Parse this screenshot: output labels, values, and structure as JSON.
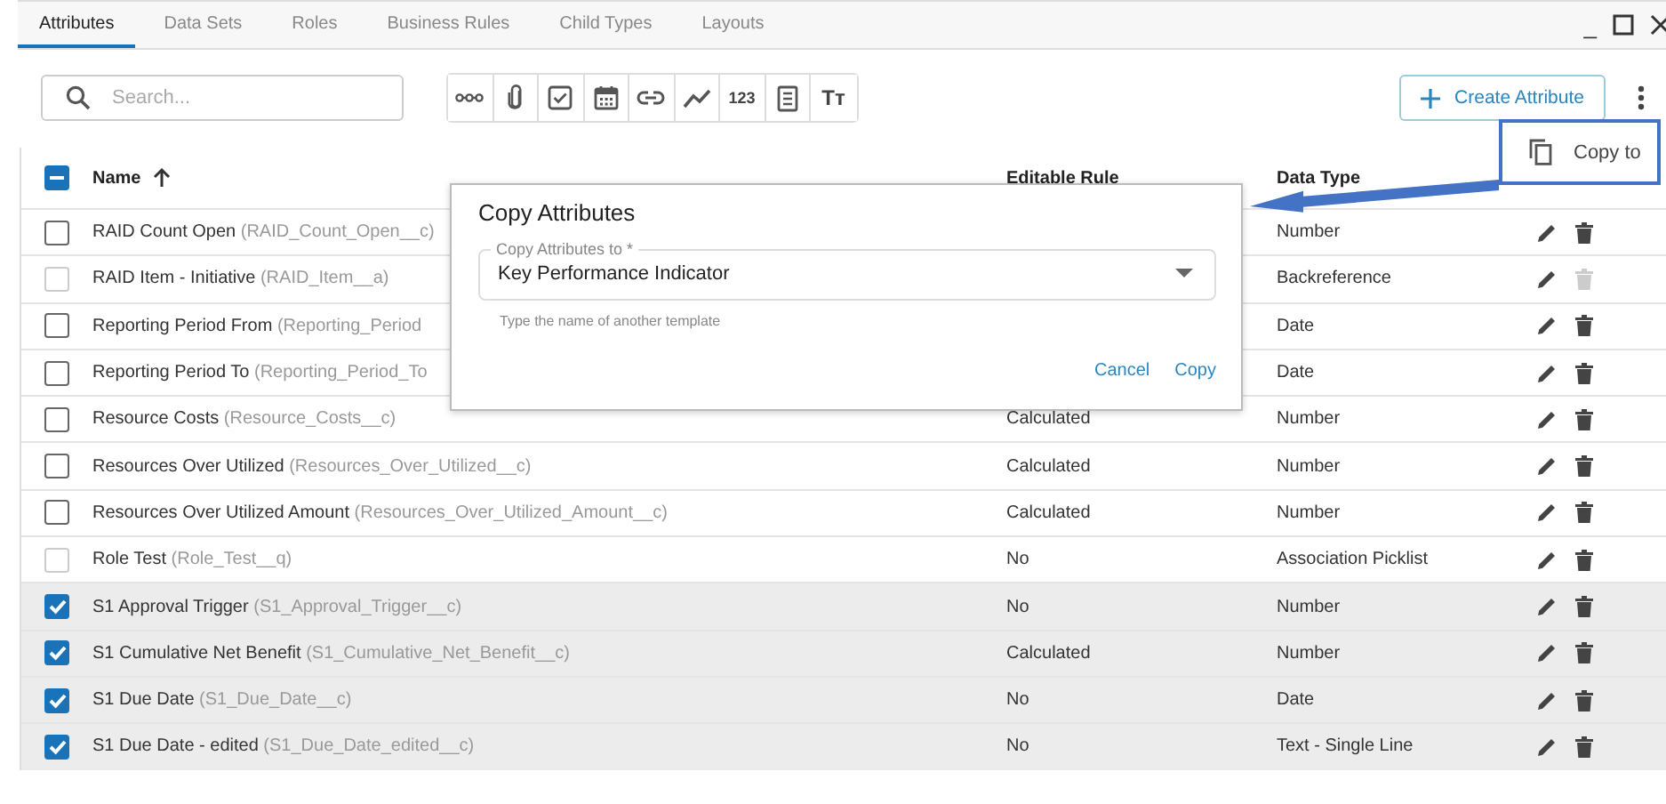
{
  "tabs": [
    {
      "label": "Attributes",
      "selected": true
    },
    {
      "label": "Data Sets",
      "selected": false
    },
    {
      "label": "Roles",
      "selected": false
    },
    {
      "label": "Business Rules",
      "selected": false
    },
    {
      "label": "Child Types",
      "selected": false
    },
    {
      "label": "Layouts",
      "selected": false
    }
  ],
  "window_controls": [
    "_"
  ],
  "search": {
    "placeholder": "Search..."
  },
  "toolbar": [
    {
      "kind": "relation"
    },
    {
      "kind": "attachment"
    },
    {
      "kind": "checkbox"
    },
    {
      "kind": "date"
    },
    {
      "kind": "link"
    },
    {
      "kind": "trend"
    },
    {
      "kind": "number",
      "label": "123"
    },
    {
      "kind": "formula"
    },
    {
      "kind": "text",
      "label": "Tт"
    }
  ],
  "create_button": "Create Attribute",
  "table": {
    "select_all_partial": true,
    "columns": [
      {
        "label": "Name",
        "sort_ascending": true
      },
      {
        "label": "Editable Rule"
      },
      {
        "label": "Data Type"
      }
    ],
    "rows": [
      {
        "name": "RAID Count Open",
        "api": "(RAID_Count_Open__c)",
        "checked": false,
        "disabled": false,
        "type": "Number",
        "delete_disabled": false
      },
      {
        "name": "RAID Item - Initiative",
        "api": "(RAID_Item__a)",
        "checked": false,
        "disabled": true,
        "type": "Backreference",
        "delete_disabled": true
      },
      {
        "name": "Reporting Period From",
        "api": "(Reporting_Period",
        "checked": false,
        "disabled": false,
        "type": "Date",
        "delete_disabled": false
      },
      {
        "name": "Reporting Period To",
        "api": "(Reporting_Period_To",
        "checked": false,
        "disabled": false,
        "type": "Date",
        "delete_disabled": false
      },
      {
        "name": "Resource Costs",
        "api": "(Resource_Costs__c)",
        "checked": false,
        "disabled": false,
        "rule": "Calculated",
        "type": "Number",
        "delete_disabled": false
      },
      {
        "name": "Resources Over Utilized",
        "api": "(Resources_Over_Utilized__c)",
        "checked": false,
        "disabled": false,
        "rule": "Calculated",
        "type": "Number",
        "delete_disabled": false
      },
      {
        "name": "Resources Over Utilized Amount",
        "api": "(Resources_Over_Utilized_Amount__c)",
        "checked": false,
        "disabled": false,
        "rule": "Calculated",
        "type": "Number",
        "delete_disabled": false
      },
      {
        "name": "Role Test",
        "api": "(Role_Test__q)",
        "checked": false,
        "disabled": true,
        "rule": "No",
        "type": "Association Picklist",
        "delete_disabled": false
      },
      {
        "name": "S1 Approval Trigger",
        "api": "(S1_Approval_Trigger__c)",
        "checked": true,
        "disabled": false,
        "rule": "No",
        "type": "Number",
        "delete_disabled": false
      },
      {
        "name": "S1 Cumulative Net Benefit",
        "api": "(S1_Cumulative_Net_Benefit__c)",
        "checked": true,
        "disabled": false,
        "rule": "Calculated",
        "type": "Number",
        "delete_disabled": false
      },
      {
        "name": "S1 Due Date",
        "api": "(S1_Due_Date__c)",
        "checked": true,
        "disabled": false,
        "rule": "No",
        "type": "Date",
        "delete_disabled": false
      },
      {
        "name": "S1 Due Date - edited",
        "api": "(S1_Due_Date_edited__c)",
        "checked": true,
        "disabled": false,
        "rule": "No",
        "type": "Text - Single Line",
        "delete_disabled": false
      }
    ]
  },
  "dialog": {
    "title": "Copy Attributes",
    "field_label": "Copy Attributes to *",
    "value": "Key Performance Indicator",
    "hint": "Type the name of another template",
    "buttons": [
      "Cancel",
      "Copy"
    ]
  },
  "popup_menu": {
    "items": [
      {
        "label": "Copy to"
      }
    ]
  }
}
